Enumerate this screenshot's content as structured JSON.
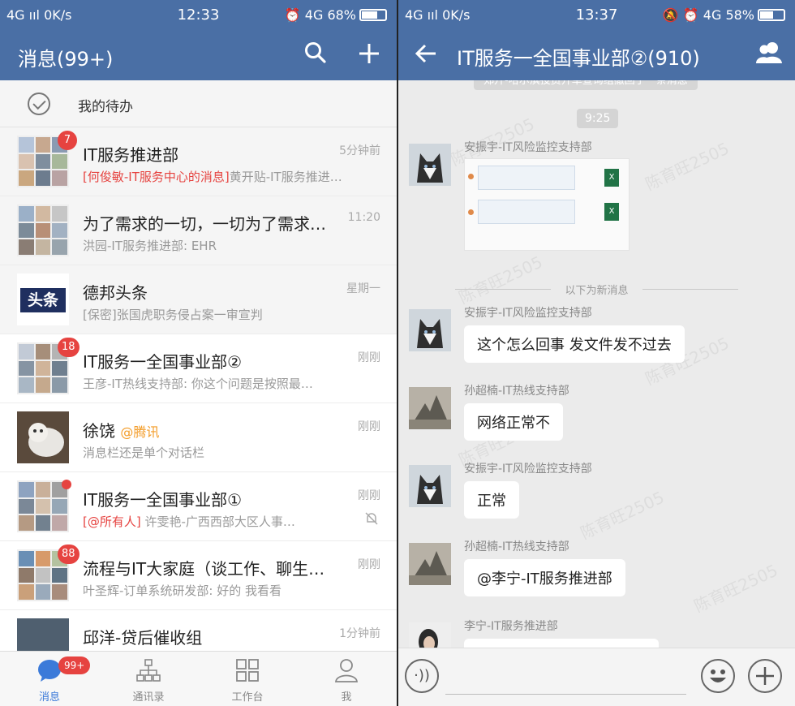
{
  "left": {
    "status": {
      "signal": "4G ııl",
      "speed": "0K/s",
      "time": "12:33",
      "net": "4G",
      "battery": "68%",
      "battery_level": 0.68
    },
    "header": {
      "title": "消息(99+)"
    },
    "todo": {
      "label": "我的待办"
    },
    "conversations": [
      {
        "name": "IT服务推进部",
        "tag": "",
        "preview_highlight": "[何俊敏-IT服务中心的消息]",
        "preview": "黄开贴-IT服务推进…",
        "time": "5分钟前",
        "badge": "7"
      },
      {
        "name": "为了需求的一切，一切为了需求…",
        "tag": "",
        "preview_highlight": "",
        "preview": "洪园-IT服务推进部: EHR",
        "time": "11:20",
        "badge": ""
      },
      {
        "name": "德邦头条",
        "tag": "",
        "preview_highlight": "",
        "preview": "[保密]张国虎职务侵占案一审宣判",
        "time": "星期一",
        "badge": "",
        "logo_text": "头条"
      },
      {
        "name": "IT服务一全国事业部②",
        "tag": "",
        "preview_highlight": "",
        "preview": "王彦-IT热线支持部: 你这个问题是按照最…",
        "time": "刚刚",
        "badge": "18"
      },
      {
        "name": "徐饶",
        "tag": "@腾讯",
        "preview_highlight": "",
        "preview": "消息栏还是单个对话栏",
        "time": "刚刚",
        "badge": ""
      },
      {
        "name": "IT服务一全国事业部①",
        "tag": "",
        "preview_highlight": "[@所有人]",
        "preview": " 许雯艳-广西西部大区人事…",
        "time": "刚刚",
        "badge": ""
      },
      {
        "name": "流程与IT大家庭（谈工作、聊生…",
        "tag": "",
        "preview_highlight": "",
        "preview": "叶圣辉-订单系统研发部: 好的 我看看",
        "time": "刚刚",
        "badge": "88"
      },
      {
        "name": "邱洋-贷后催收组",
        "tag": "",
        "preview_highlight": "",
        "preview": "",
        "time": "1分钟前",
        "badge": ""
      }
    ],
    "tabs": [
      {
        "label": "消息",
        "badge": "99+"
      },
      {
        "label": "通讯录"
      },
      {
        "label": "工作台"
      },
      {
        "label": "我"
      }
    ]
  },
  "right": {
    "status": {
      "signal": "4G ııl",
      "speed": "0K/s",
      "time": "13:37",
      "net": "4G",
      "battery": "58%",
      "battery_level": 0.58
    },
    "header": {
      "title": "IT服务一全国事业部②(910)"
    },
    "system_note": "郑升-哈尔滨投资开单查询组撤回了一条消息",
    "time_chip": "9:25",
    "new_divider": "以下为新消息",
    "watermark": "陈育旺2505",
    "messages": [
      {
        "sender": "安振宇-IT风险监控支持部",
        "text": ""
      },
      {
        "sender": "安振宇-IT风险监控支持部",
        "text": "这个怎么回事 发文件发不过去"
      },
      {
        "sender": "孙超楠-IT热线支持部",
        "text": "网络正常不"
      },
      {
        "sender": "安振宇-IT风险监控支持部",
        "text": "正常"
      },
      {
        "sender": "孙超楠-IT热线支持部",
        "text": "@李宁-IT服务推进部"
      },
      {
        "sender": "李宁-IT服务推进部",
        "text": ""
      }
    ]
  },
  "colors": {
    "header": "#4a6fa5",
    "badge": "#e64340",
    "accent": "#3b7ad9"
  }
}
